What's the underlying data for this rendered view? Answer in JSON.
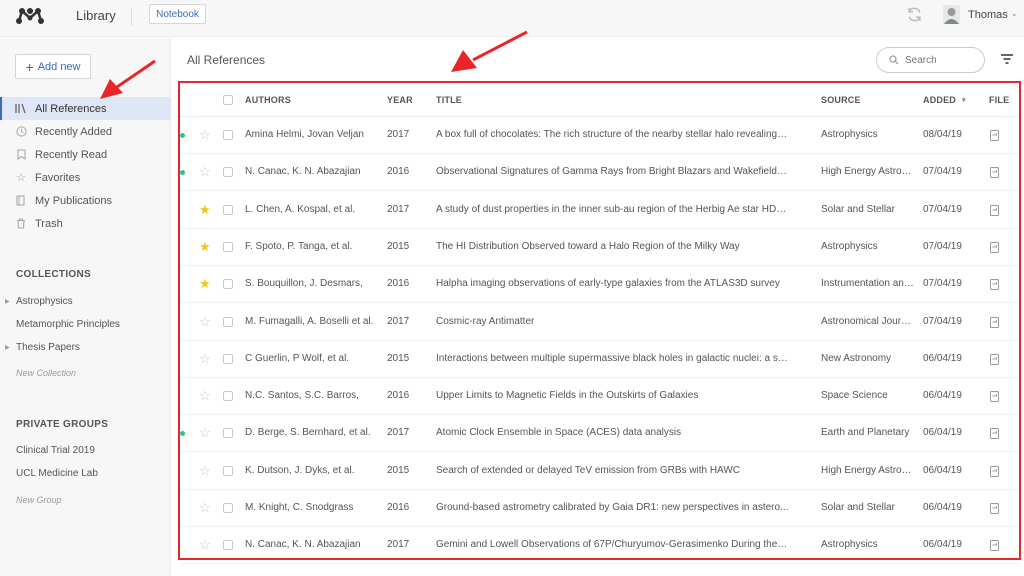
{
  "topbar": {
    "app_section": "Library",
    "notebook_label": "Notebook",
    "user_name": "Thomas",
    "icons": {
      "logo": "mendeley-logo",
      "sync": "sync-icon",
      "avatar": "user-avatar",
      "chevron": "chevron-down-icon"
    }
  },
  "sidebar": {
    "add_new_label": "Add new",
    "nav": [
      {
        "label": "All References",
        "icon": "library-icon",
        "active": true
      },
      {
        "label": "Recently Added",
        "icon": "clock-icon",
        "active": false
      },
      {
        "label": "Recently Read",
        "icon": "bookmark-icon",
        "active": false
      },
      {
        "label": "Favorites",
        "icon": "star-icon",
        "active": false
      },
      {
        "label": "My Publications",
        "icon": "publications-icon",
        "active": false
      },
      {
        "label": "Trash",
        "icon": "trash-icon",
        "active": false
      }
    ],
    "collections_title": "COLLECTIONS",
    "collections": [
      {
        "label": "Astrophysics",
        "expandable": true
      },
      {
        "label": "Metamorphic Principles",
        "expandable": false
      },
      {
        "label": "Thesis Papers",
        "expandable": true
      }
    ],
    "new_collection_label": "New Collection",
    "groups_title": "PRIVATE GROUPS",
    "groups": [
      {
        "label": "Clinical Trial 2019"
      },
      {
        "label": "UCL Medicine Lab"
      }
    ],
    "new_group_label": "New Group"
  },
  "main": {
    "title": "All References",
    "search_placeholder": "Search",
    "columns": {
      "authors": "AUTHORS",
      "year": "YEAR",
      "title": "TITLE",
      "source": "SOURCE",
      "added": "ADDED",
      "added_sort": "▾",
      "file": "FILE"
    },
    "rows": [
      {
        "unread": true,
        "favorite": false,
        "authors": "Amina Helmi, Jovan Veljan",
        "year": "2017",
        "title": "A box full of chocolates: The rich structure of the nearby stellar halo revealing…",
        "source": "Astrophysics",
        "added": "08/04/19"
      },
      {
        "unread": true,
        "favorite": false,
        "authors": "N. Canac, K. N. Abazajian",
        "year": "2016",
        "title": "Observational Signatures of Gamma Rays from Bright Blazars and Wakefield…",
        "source": "High Energy Astro…",
        "added": "07/04/19"
      },
      {
        "unread": false,
        "favorite": true,
        "authors": "L. Chen, A. Kospal, et al.",
        "year": "2017",
        "title": "A study of dust properties in the inner sub-au region of the Herbig Ae star HD…",
        "source": "Solar and Stellar",
        "added": "07/04/19"
      },
      {
        "unread": false,
        "favorite": true,
        "authors": "F. Spoto, P. Tanga, et al.",
        "year": "2015",
        "title": "The HI Distribution Observed toward a Halo Region of the Milky Way",
        "source": "Astrophysics",
        "added": "07/04/19"
      },
      {
        "unread": false,
        "favorite": true,
        "authors": "S. Bouquillon, J. Desmars,",
        "year": "2016",
        "title": "Halpha imaging observations of early-type galaxies from the ATLAS3D survey",
        "source": "Instrumentation an…",
        "added": "07/04/19"
      },
      {
        "unread": false,
        "favorite": false,
        "authors": "M. Fumagalli, A. Boselli et al.",
        "year": "2017",
        "title": "Cosmic-ray Antimatter",
        "source": "Astronomical Jour…",
        "added": "07/04/19"
      },
      {
        "unread": false,
        "favorite": false,
        "authors": "C Guerlin, P Wolf, et al.",
        "year": "2015",
        "title": "Interactions between multiple supermassive black holes in galactic nuclei: a s…",
        "source": "New Astronomy",
        "added": "06/04/19"
      },
      {
        "unread": false,
        "favorite": false,
        "authors": "N.C. Santos, S.C. Barros,",
        "year": "2016",
        "title": "Upper Limits to Magnetic Fields in the Outskirts of Galaxies",
        "source": "Space Science",
        "added": "06/04/19"
      },
      {
        "unread": true,
        "favorite": false,
        "authors": "D. Berge, S. Bernhard, et al.",
        "year": "2017",
        "title": "Atomic Clock Ensemble in Space (ACES) data analysis",
        "source": "Earth and Planetary",
        "added": "06/04/19"
      },
      {
        "unread": false,
        "favorite": false,
        "authors": "K. Dutson, J. Dyks, et al.",
        "year": "2015",
        "title": "Search of extended or delayed TeV emission from GRBs with HAWC",
        "source": "High Energy Astro…",
        "added": "06/04/19"
      },
      {
        "unread": false,
        "favorite": false,
        "authors": "M. Knight, C. Snodgrass",
        "year": "2016",
        "title": "Ground-based astrometry calibrated by Gaia DR1: new perspectives in astero...",
        "source": "Solar and Stellar",
        "added": "06/04/19"
      },
      {
        "unread": false,
        "favorite": false,
        "authors": "N. Canac, K. N. Abazajian",
        "year": "2017",
        "title": "Gemini and Lowell Observations of 67P/Churyumov-Gerasimenko During the…",
        "source": "Astrophysics",
        "added": "06/04/19"
      }
    ]
  },
  "annotations": {
    "highlight_color": "#e8262a",
    "arrows": 2
  }
}
